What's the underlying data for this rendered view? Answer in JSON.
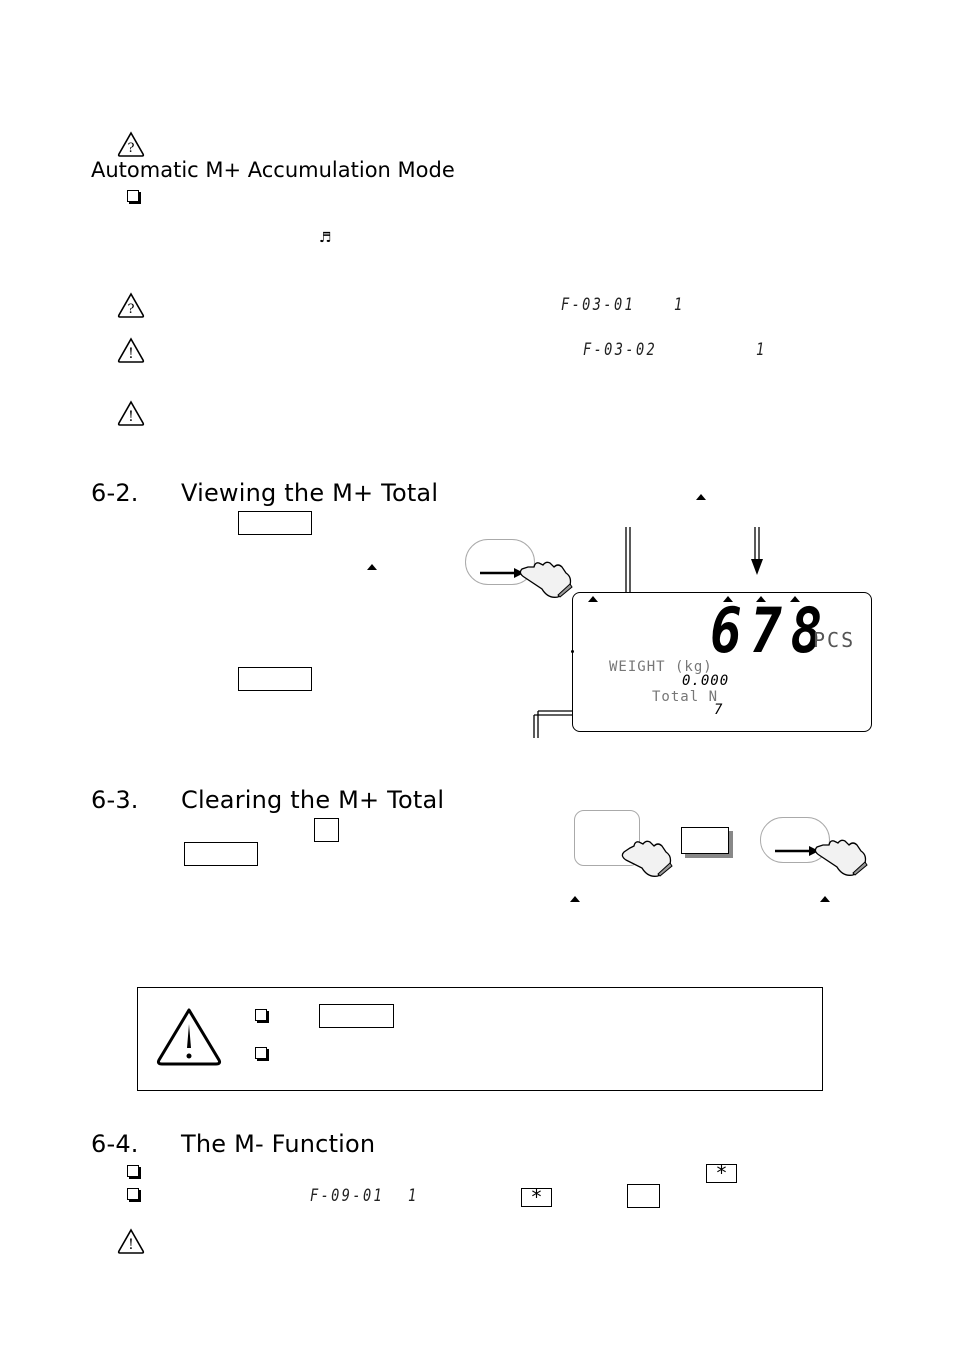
{
  "sections": {
    "auto_mode": {
      "heading": "Automatic M+ Accumulation Mode",
      "icons": [
        "question-caution-icon",
        "checkbox-bullet-icon",
        "music-note-icon"
      ],
      "notes": [
        {
          "icon": "question-caution-icon",
          "display_code": "F-03-01",
          "display_value": "1"
        },
        {
          "icon": "warning-icon",
          "display_code": "F-03-02",
          "display_value": "1"
        },
        {
          "icon": "warning-icon"
        }
      ]
    },
    "viewing": {
      "number": "6-2.",
      "title": "Viewing the M+ Total"
    },
    "clearing": {
      "number": "6-3.",
      "title": "Clearing the M+ Total"
    },
    "m_minus": {
      "number": "6-4.",
      "title": "The M- Function",
      "display_code": "F-09-01",
      "display_value": "1",
      "star_key": "*"
    }
  },
  "lcd": {
    "count": "678",
    "unit": "PCS",
    "weight_label": "WEIGHT (kg)",
    "weight_value": "0.000",
    "total_label": "Total N",
    "total_value": "7"
  }
}
